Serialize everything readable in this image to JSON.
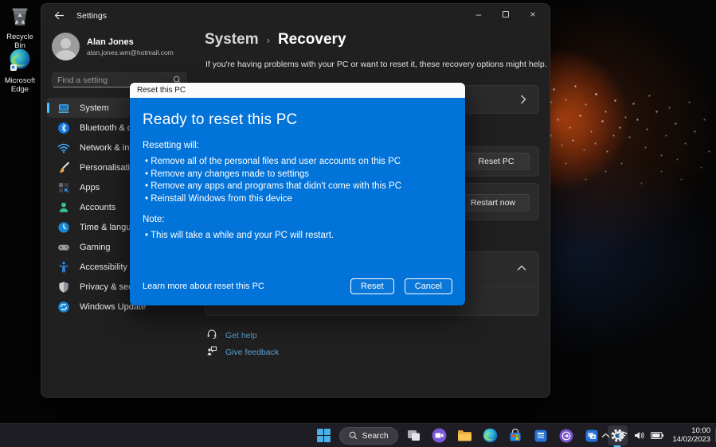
{
  "colors": {
    "dialog_blue": "#0273d8",
    "accent_blue": "#4cc2ff",
    "link_blue": "#55a0d8"
  },
  "desktop": {
    "icons": [
      {
        "icon": "recycle-bin",
        "label": "Recycle Bin"
      },
      {
        "icon": "microsoft-edge",
        "label": "Microsoft Edge"
      }
    ]
  },
  "window": {
    "titlebar": {
      "title": "Settings"
    },
    "sidebar": {
      "user": {
        "name": "Alan Jones",
        "email": "alan.jones.wm@hotmail.com"
      },
      "search": {
        "placeholder": "Find a setting"
      },
      "items": [
        {
          "icon": "system",
          "label": "System",
          "selected": true
        },
        {
          "icon": "bluetooth",
          "label": "Bluetooth & devices"
        },
        {
          "icon": "network",
          "label": "Network & internet"
        },
        {
          "icon": "personalisation",
          "label": "Personalisation"
        },
        {
          "icon": "apps",
          "label": "Apps"
        },
        {
          "icon": "accounts",
          "label": "Accounts"
        },
        {
          "icon": "time-language",
          "label": "Time & language"
        },
        {
          "icon": "gaming",
          "label": "Gaming"
        },
        {
          "icon": "accessibility",
          "label": "Accessibility"
        },
        {
          "icon": "privacy-security",
          "label": "Privacy & security"
        },
        {
          "icon": "windows-update",
          "label": "Windows Update"
        }
      ]
    },
    "main": {
      "breadcrumb": {
        "parent": "System",
        "separator": "›",
        "current": "Recovery"
      },
      "description": "If you're having problems with your PC or want to reset it, these recovery options might help.",
      "reset_pc_button": "Reset PC",
      "restart_now_button": "Restart now",
      "links": {
        "get_help": "Get help",
        "give_feedback": "Give feedback"
      }
    }
  },
  "dialog": {
    "title": "Reset this PC",
    "heading": "Ready to reset this PC",
    "intro": "Resetting will:",
    "bullets": [
      "Remove all of the personal files and user accounts on this PC",
      "Remove any changes made to settings",
      "Remove any apps and programs that didn't come with this PC",
      "Reinstall Windows from this device"
    ],
    "note_label": "Note:",
    "note_bullet": "This will take a while and your PC will restart.",
    "learn_more": "Learn more about reset this PC",
    "buttons": {
      "reset": "Reset",
      "cancel": "Cancel"
    }
  },
  "taskbar": {
    "search_label": "Search",
    "tray": {
      "time": "10:00",
      "date": "14/02/2023"
    }
  }
}
